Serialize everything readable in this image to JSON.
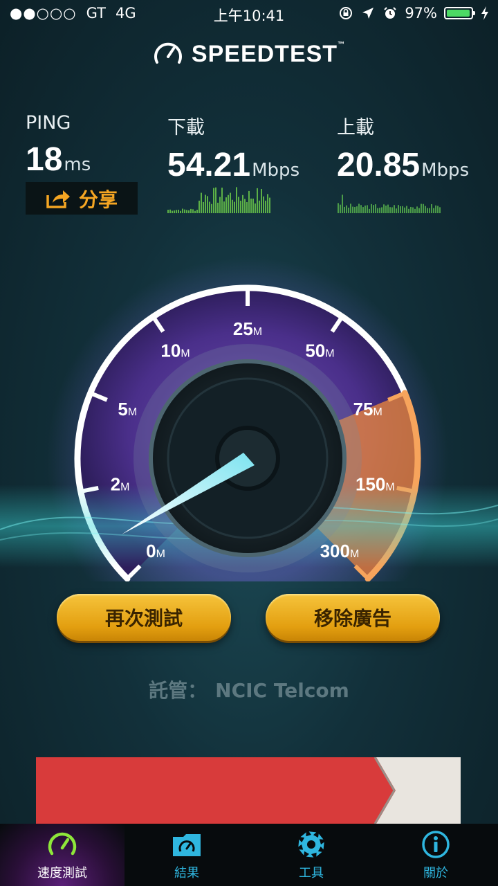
{
  "status_bar": {
    "signal": "●●○○○",
    "carrier": "GT",
    "network": "4G",
    "time": "上午10:41",
    "battery": "97%",
    "battery_level": 0.97
  },
  "header": {
    "title": "SPEEDTEST",
    "trademark": "™"
  },
  "ping": {
    "label": "PING",
    "value": "18",
    "unit": "ms"
  },
  "download": {
    "label": "下載",
    "value": "54.21",
    "unit": "Mbps"
  },
  "upload": {
    "label": "上載",
    "value": "20.85",
    "unit": "Mbps"
  },
  "share": {
    "label": "分享"
  },
  "gauge": {
    "ticks": [
      {
        "value": "0",
        "unit": "M"
      },
      {
        "value": "2",
        "unit": "M"
      },
      {
        "value": "5",
        "unit": "M"
      },
      {
        "value": "10",
        "unit": "M"
      },
      {
        "value": "25",
        "unit": "M"
      },
      {
        "value": "50",
        "unit": "M"
      },
      {
        "value": "75",
        "unit": "M"
      },
      {
        "value": "150",
        "unit": "M"
      },
      {
        "value": "300",
        "unit": "M"
      }
    ]
  },
  "actions": {
    "retest": "再次測試",
    "remove_ads": "移除廣告"
  },
  "host": {
    "label": "託管：",
    "name": "NCIC Telcom"
  },
  "colors": {
    "accent": "#f0b323",
    "tab_active": "#5a1f78",
    "tab_text": "#2fb6df",
    "gauge_high": "#f08a3a"
  },
  "tabs": [
    {
      "label": "速度測試",
      "icon": "speedometer-icon",
      "active": true
    },
    {
      "label": "結果",
      "icon": "results-folder-icon",
      "active": false
    },
    {
      "label": "工具",
      "icon": "gear-icon",
      "active": false
    },
    {
      "label": "關於",
      "icon": "info-icon",
      "active": false
    }
  ]
}
